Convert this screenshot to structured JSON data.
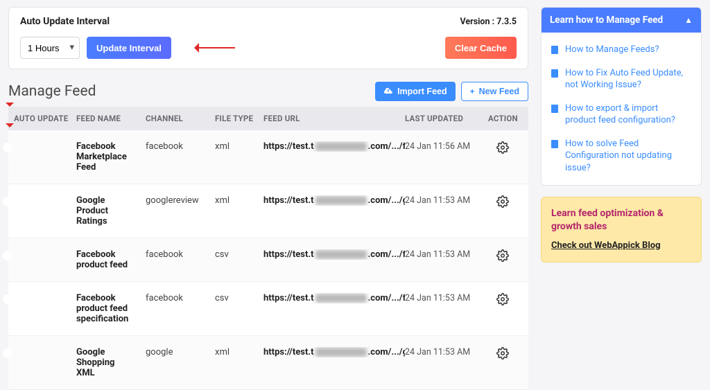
{
  "top": {
    "title": "Auto Update Interval",
    "version_label": "Version : 7.3.5",
    "interval_selected": "1 Hours",
    "update_btn": "Update Interval",
    "clear_btn": "Clear Cache"
  },
  "section": {
    "title": "Manage Feed",
    "import_btn": "Import Feed",
    "new_btn": "New Feed"
  },
  "table": {
    "headers": {
      "auto": "AUTO UPDATE",
      "name": "FEED NAME",
      "channel": "CHANNEL",
      "ftype": "FILE TYPE",
      "url": "FEED URL",
      "updated": "LAST UPDATED",
      "action": "ACTION"
    },
    "rows": [
      {
        "name": "Facebook Marketplace Feed",
        "channel": "facebook",
        "ftype": "xml",
        "url_pre": "https://test.t",
        "url_post": ".com/.../fa...",
        "updated": "24 Jan 11:56 AM"
      },
      {
        "name": "Google Product Ratings",
        "channel": "googlereview",
        "ftype": "xml",
        "url_pre": "https://test.t",
        "url_post": ".com/.../g...",
        "updated": "24 Jan 11:53 AM"
      },
      {
        "name": "Facebook product feed",
        "channel": "facebook",
        "ftype": "csv",
        "url_pre": "https://test.t",
        "url_post": ".com/.../fa...",
        "updated": "24 Jan 11:53 AM"
      },
      {
        "name": "Facebook product feed specification",
        "channel": "facebook",
        "ftype": "csv",
        "url_pre": "https://test.t",
        "url_post": ".com/.../fa...",
        "updated": "24 Jan 11:53 AM"
      },
      {
        "name": "Google Shopping XML",
        "channel": "google",
        "ftype": "xml",
        "url_pre": "https://test.t",
        "url_post": ".com/.../g...",
        "updated": "24 Jan 11:53 AM"
      }
    ]
  },
  "help": {
    "title": "Learn how to Manage Feed",
    "items": [
      "How to Manage Feeds?",
      "How to Fix Auto Feed Update, not Working Issue?",
      "How to export & import product feed configuration?",
      "How to solve Feed Configuration not updating issue?"
    ]
  },
  "promo": {
    "title": "Learn feed optimization & growth sales",
    "link": "Check out WebAppick Blog"
  }
}
